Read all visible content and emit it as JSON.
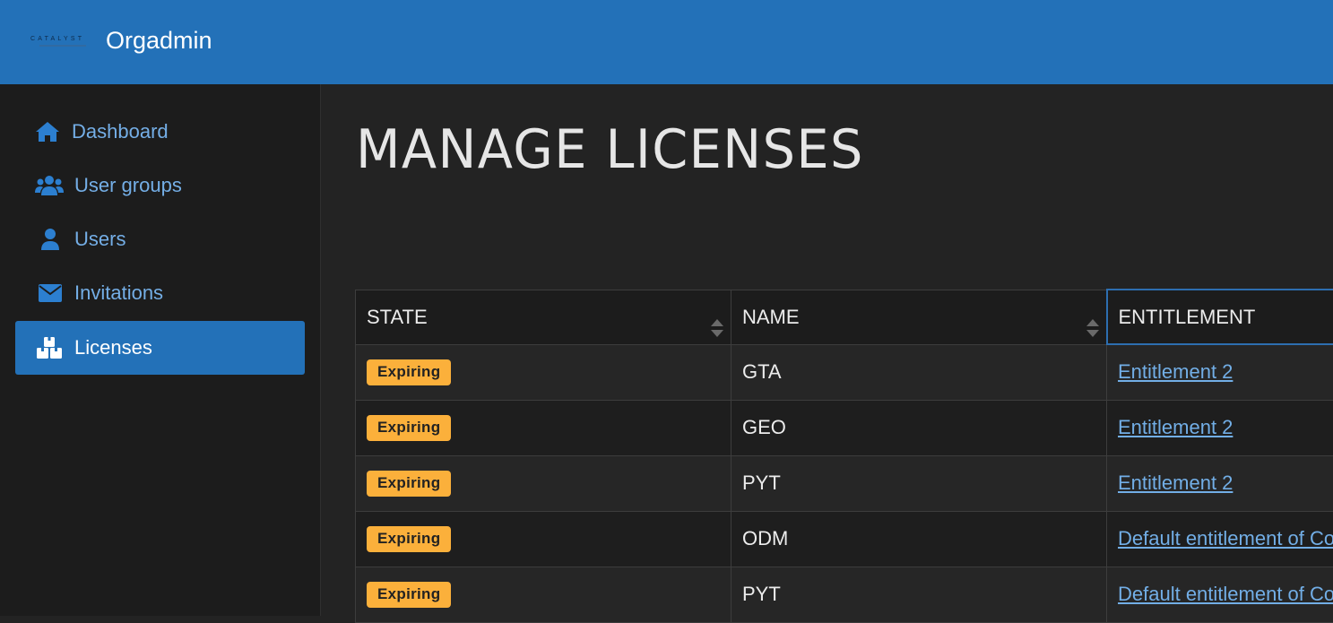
{
  "header": {
    "logo_text": "CATALYST",
    "app_title": "Orgadmin"
  },
  "sidebar": {
    "items": [
      {
        "label": "Dashboard",
        "icon": "home-icon"
      },
      {
        "label": "User groups",
        "icon": "users-icon"
      },
      {
        "label": "Users",
        "icon": "user-icon"
      },
      {
        "label": "Invitations",
        "icon": "envelope-icon"
      },
      {
        "label": "Licenses",
        "icon": "boxes-icon",
        "active": true
      }
    ]
  },
  "main": {
    "title": "MANAGE LICENSES",
    "table": {
      "columns": [
        "STATE",
        "NAME",
        "ENTITLEMENT"
      ],
      "rows": [
        {
          "state": "Expiring",
          "name": "GTA",
          "entitlement": "Entitlement 2"
        },
        {
          "state": "Expiring",
          "name": "GEO",
          "entitlement": "Entitlement 2"
        },
        {
          "state": "Expiring",
          "name": "PYT",
          "entitlement": "Entitlement 2"
        },
        {
          "state": "Expiring",
          "name": "ODM",
          "entitlement": "Default entitlement of Co"
        },
        {
          "state": "Expiring",
          "name": "PYT",
          "entitlement": "Default entitlement of Co"
        }
      ]
    }
  },
  "colors": {
    "header_bg": "#2371b8",
    "sidebar_bg": "#1c1c1c",
    "main_bg": "#232323",
    "link": "#72aee6",
    "badge_bg": "#fbb03b"
  }
}
